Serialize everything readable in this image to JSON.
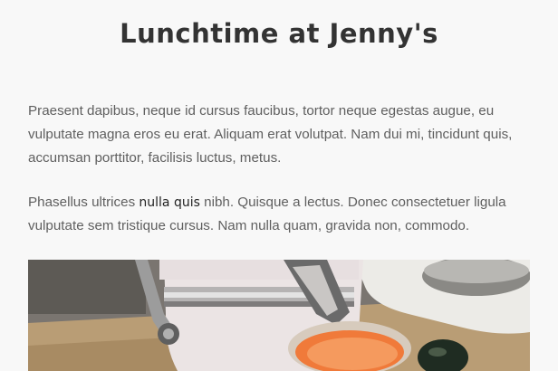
{
  "article": {
    "title": "Lunchtime at Jenny's",
    "paragraph1": "Praesent dapibus, neque id cursus faucibus, tortor neque egestas augue, eu vulputate magna eros eu erat. Aliquam erat volutpat. Nam dui mi, tincidunt quis, accumsan porttitor, facilisis luctus, metus.",
    "paragraph2_before": "Phasellus ultrices ",
    "paragraph2_emphasis": "nulla quis",
    "paragraph2_after": " nibh. Quisque a lectus. Donec consectetuer ligula vulputate sem tristique cursus. Nam nulla quam, gravida non, commodo."
  },
  "colors": {
    "background": "#f8f8f8",
    "title": "#333333",
    "body_text": "#5f5f5f",
    "emphasis_text": "#222222"
  }
}
